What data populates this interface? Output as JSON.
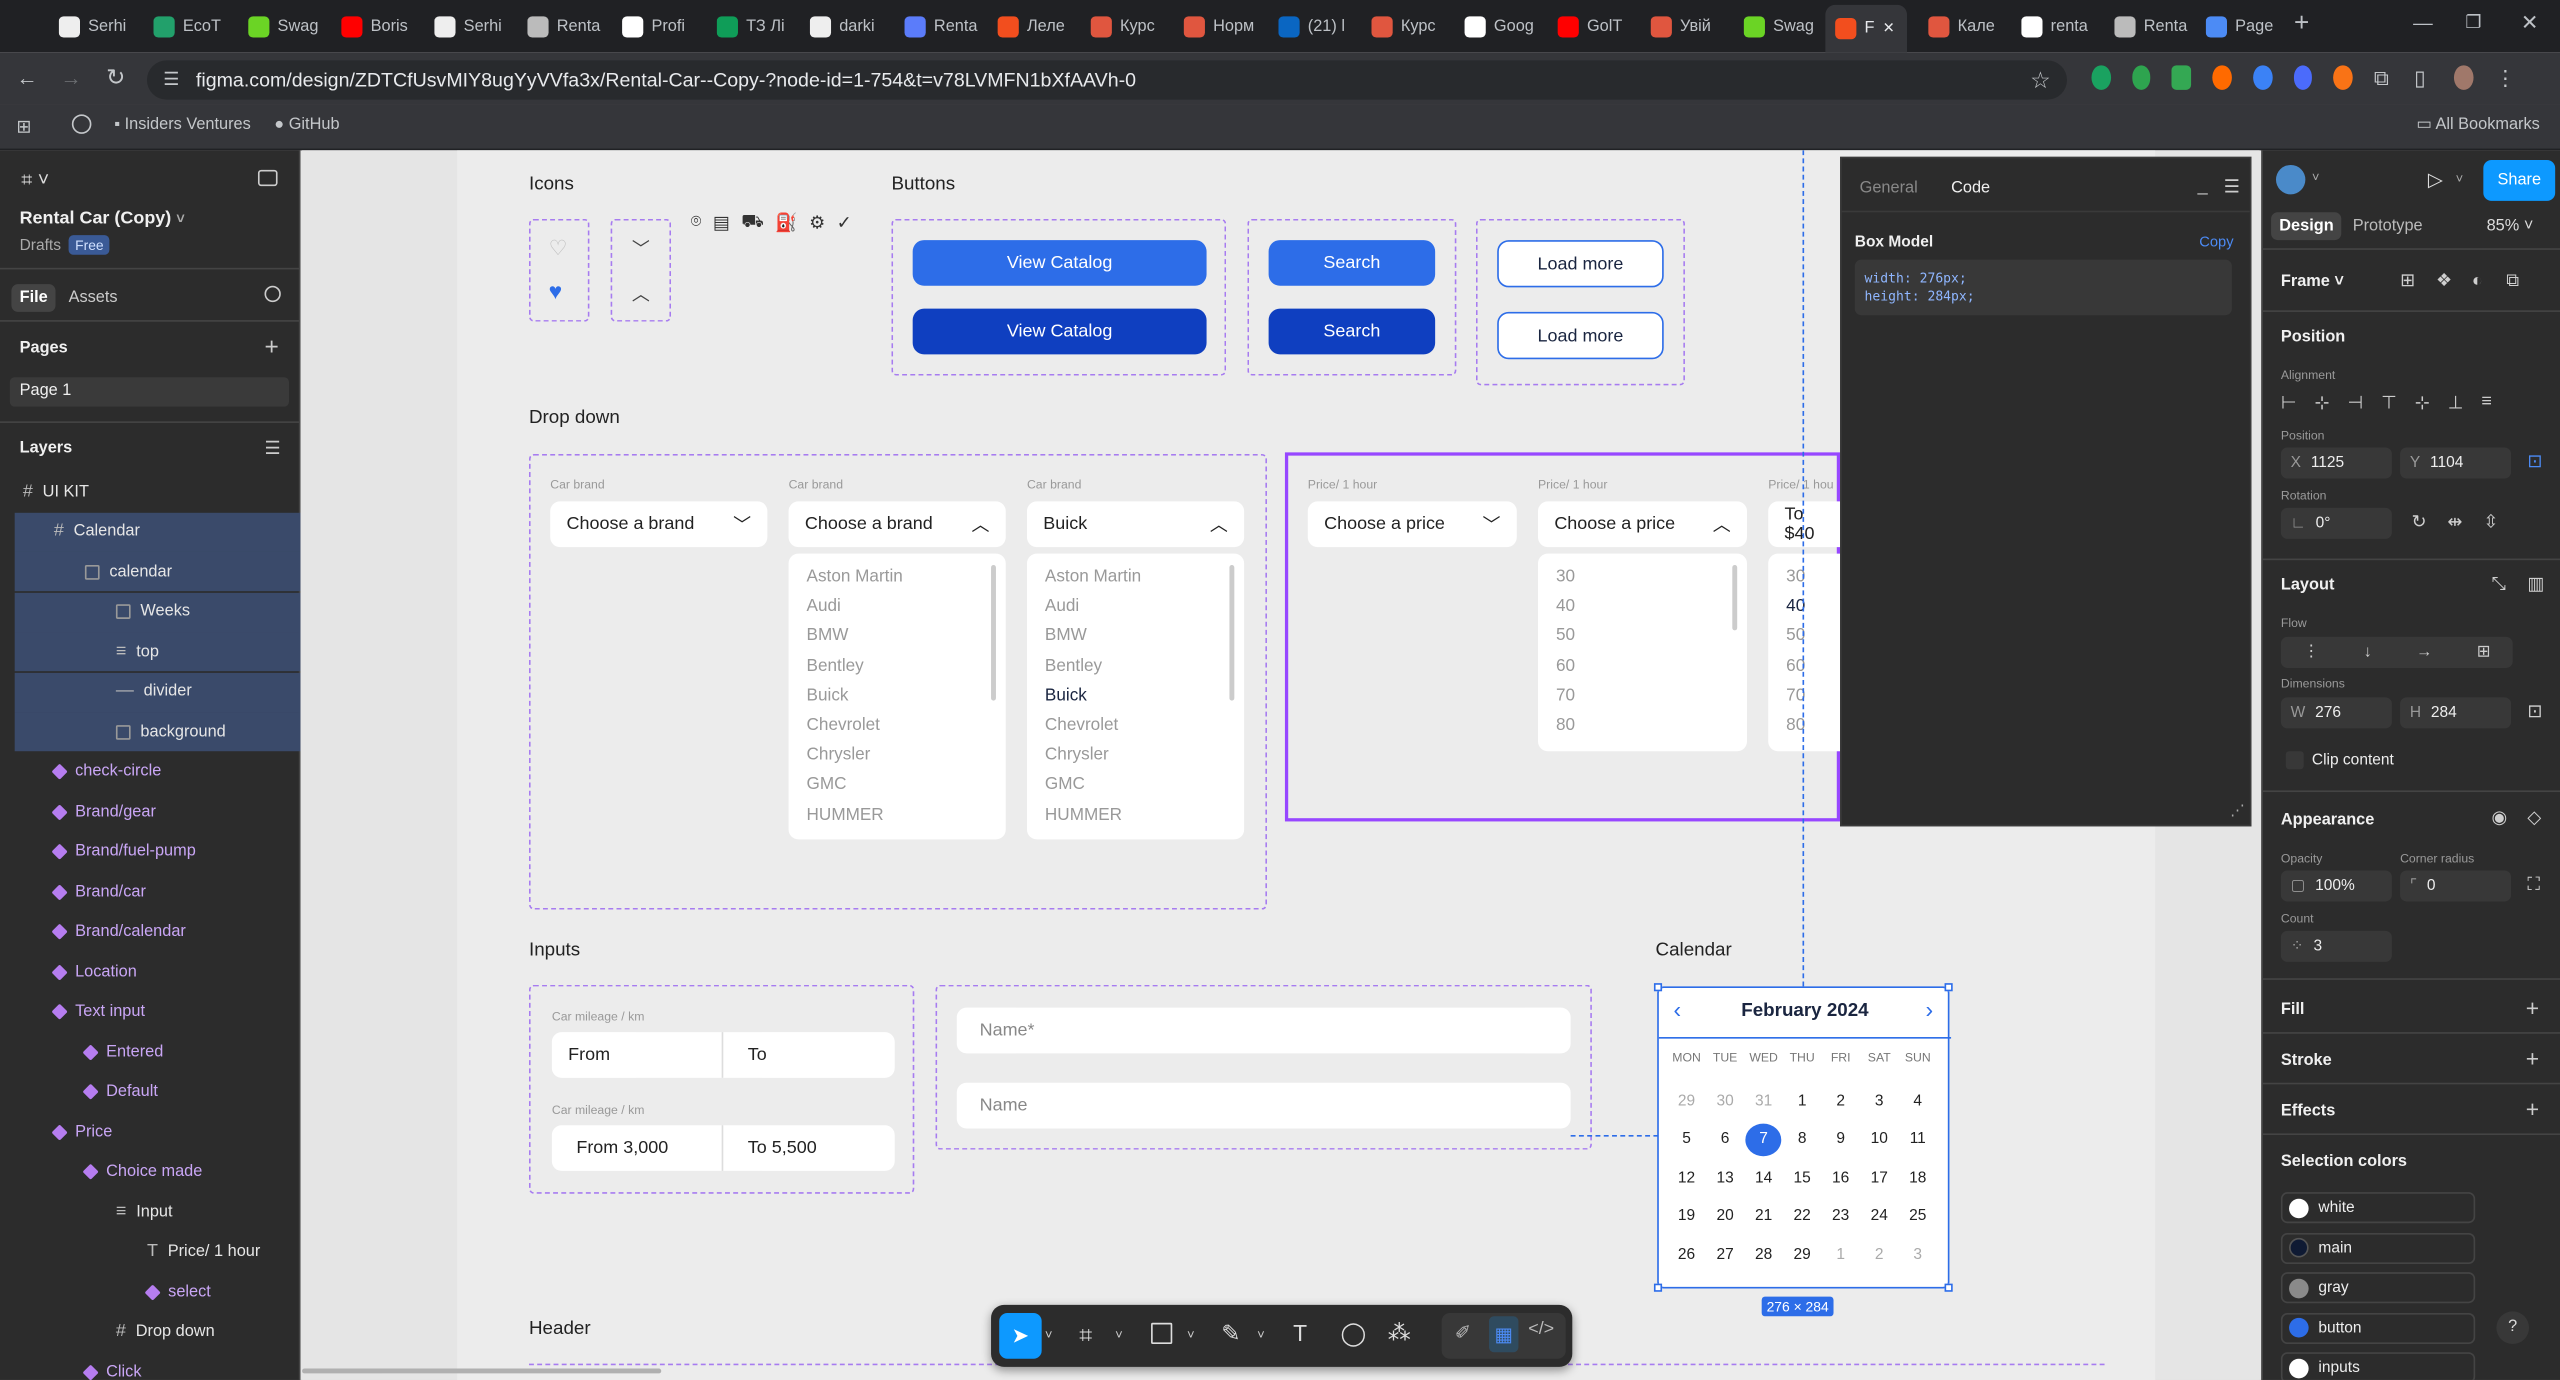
{
  "browser": {
    "tabs": [
      {
        "label": "Serhi",
        "color": "#eee"
      },
      {
        "label": "EcoT",
        "color": "#22a06b"
      },
      {
        "label": "Swag",
        "color": "#6bd425"
      },
      {
        "label": "Boris",
        "color": "#ff0000"
      },
      {
        "label": "Serhi",
        "color": "#eee"
      },
      {
        "label": "Renta",
        "color": "#bbb"
      },
      {
        "label": "Profi",
        "color": "#fff"
      },
      {
        "label": "ТЗ Лі",
        "color": "#0f9d58"
      },
      {
        "label": "darki",
        "color": "#eee"
      },
      {
        "label": "Renta",
        "color": "#5b7cfa"
      },
      {
        "label": "Леле",
        "color": "#f24e1e"
      },
      {
        "label": "Курс",
        "color": "#e0563f"
      },
      {
        "label": "Норм",
        "color": "#e0563f"
      },
      {
        "label": "(21) l",
        "color": "#0a66c2"
      },
      {
        "label": "Курс",
        "color": "#e0563f"
      },
      {
        "label": "Goog",
        "color": "#fff"
      },
      {
        "label": "GolT",
        "color": "#ff0000"
      },
      {
        "label": "Увій",
        "color": "#e0563f"
      },
      {
        "label": "Swag",
        "color": "#6bd425"
      },
      {
        "label": "F",
        "color": "#f24e1e"
      },
      {
        "label": "Кале",
        "color": "#e0563f"
      },
      {
        "label": "renta",
        "color": "#fff"
      },
      {
        "label": "Renta",
        "color": "#bbb"
      },
      {
        "label": "Page",
        "color": "#4c8bf5"
      }
    ],
    "url": "figma.com/design/ZDTCfUsvMIY8ugYyVVfa3x/Rental-Car--Copy-?node-id=1-754&t=v78LVMFN1bXfAAVh-0",
    "bookmarks": [
      "Insiders Ventures",
      "GitHub"
    ],
    "all_bookmarks": "All Bookmarks"
  },
  "left_panel": {
    "file_name": "Rental Car (Copy)",
    "drafts": "Drafts",
    "plan": "Free",
    "tabs": [
      "File",
      "Assets"
    ],
    "pages_title": "Pages",
    "page": "Page 1",
    "layers_title": "Layers",
    "layers": [
      {
        "label": "UI KIT",
        "indent": 0,
        "kind": "frame",
        "sel": false
      },
      {
        "label": "Calendar",
        "indent": 1,
        "kind": "frame",
        "sel": true
      },
      {
        "label": "calendar",
        "indent": 2,
        "kind": "box",
        "sel": true
      },
      {
        "label": "Weeks",
        "indent": 3,
        "kind": "box",
        "sel": true
      },
      {
        "label": "top",
        "indent": 3,
        "kind": "lines",
        "sel": true
      },
      {
        "label": "divider",
        "indent": 3,
        "kind": "line",
        "sel": true
      },
      {
        "label": "background",
        "indent": 3,
        "kind": "box",
        "sel": true
      },
      {
        "label": "check-circle",
        "indent": 1,
        "kind": "comp",
        "sel": false
      },
      {
        "label": "Brand/gear",
        "indent": 1,
        "kind": "comp",
        "sel": false
      },
      {
        "label": "Brand/fuel-pump",
        "indent": 1,
        "kind": "comp",
        "sel": false
      },
      {
        "label": "Brand/car",
        "indent": 1,
        "kind": "comp",
        "sel": false
      },
      {
        "label": "Brand/calendar",
        "indent": 1,
        "kind": "comp",
        "sel": false
      },
      {
        "label": "Location",
        "indent": 1,
        "kind": "comp",
        "sel": false
      },
      {
        "label": "Text input",
        "indent": 1,
        "kind": "comp",
        "sel": false
      },
      {
        "label": "Entered",
        "indent": 2,
        "kind": "comp",
        "sel": false
      },
      {
        "label": "Default",
        "indent": 2,
        "kind": "comp",
        "sel": false
      },
      {
        "label": "Price",
        "indent": 1,
        "kind": "comp",
        "sel": false
      },
      {
        "label": "Choice made",
        "indent": 2,
        "kind": "comp",
        "sel": false
      },
      {
        "label": "Input",
        "indent": 3,
        "kind": "lines",
        "sel": false
      },
      {
        "label": "Price/ 1 hour",
        "indent": 4,
        "kind": "text",
        "sel": false
      },
      {
        "label": "select",
        "indent": 4,
        "kind": "comp",
        "sel": false
      },
      {
        "label": "Drop down",
        "indent": 3,
        "kind": "frame",
        "sel": false
      },
      {
        "label": "Click",
        "indent": 2,
        "kind": "comp",
        "sel": false
      }
    ]
  },
  "canvas": {
    "icons_title": "Icons",
    "buttons_title": "Buttons",
    "btn_catalog": "View Catalog",
    "btn_search": "Search",
    "btn_load": "Load more",
    "dropdown_title": "Drop down",
    "car_brand_label": "Car brand",
    "choose_brand": "Choose a brand",
    "buick": "Buick",
    "brands": [
      "Aston Martin",
      "Audi",
      "BMW",
      "Bentley",
      "Buick",
      "Chevrolet",
      "Chrysler",
      "GMC",
      "HUMMER"
    ],
    "price_label": "Price/ 1 hour",
    "price_label_cut": "Price/ 1 hou",
    "choose_price": "Choose a price",
    "price_to": "To $40",
    "prices": [
      "30",
      "40",
      "50",
      "60",
      "70",
      "80"
    ],
    "inputs_title": "Inputs",
    "mileage_label": "Car mileage / km",
    "from": "From",
    "to": "To",
    "from_val": "From 3,000",
    "to_val": "To 5,500",
    "name_req": "Name*",
    "name": "Name",
    "calendar_title": "Calendar",
    "header_title": "Header",
    "calendar": {
      "month": "February 2024",
      "weekdays": [
        "MON",
        "TUE",
        "WED",
        "THU",
        "FRI",
        "SAT",
        "SUN"
      ],
      "weeks": [
        [
          "29",
          "30",
          "31",
          "1",
          "2",
          "3",
          "4"
        ],
        [
          "5",
          "6",
          "7",
          "8",
          "9",
          "10",
          "11"
        ],
        [
          "12",
          "13",
          "14",
          "15",
          "16",
          "17",
          "18"
        ],
        [
          "19",
          "20",
          "21",
          "22",
          "23",
          "24",
          "25"
        ],
        [
          "26",
          "27",
          "28",
          "29",
          "1",
          "2",
          "3"
        ]
      ],
      "selected": "7",
      "size_badge": "276 × 284"
    }
  },
  "code_panel": {
    "tabs": [
      "General",
      "Code"
    ],
    "title": "Box Model",
    "copy": "Copy",
    "line1": "width: 276px;",
    "line2": "height: 284px;"
  },
  "right_panel": {
    "share": "Share",
    "tabs": [
      "Design",
      "Prototype"
    ],
    "zoom": "85%",
    "frame": "Frame",
    "position": "Position",
    "alignment": "Alignment",
    "position_label": "Position",
    "x": "1125",
    "y": "1104",
    "rotation_label": "Rotation",
    "rotation": "0°",
    "layout": "Layout",
    "flow": "Flow",
    "dimensions": "Dimensions",
    "w": "276",
    "h": "284",
    "clip": "Clip content",
    "appearance": "Appearance",
    "opacity_label": "Opacity",
    "opacity": "100%",
    "radius_label": "Corner radius",
    "radius": "0",
    "count_label": "Count",
    "count": "3",
    "fill": "Fill",
    "stroke": "Stroke",
    "effects": "Effects",
    "selection_colors": "Selection colors",
    "colors": [
      {
        "name": "white",
        "hex": "#ffffff"
      },
      {
        "name": "main",
        "hex": "#0f1a33"
      },
      {
        "name": "gray",
        "hex": "#8a8a8a"
      },
      {
        "name": "button",
        "hex": "#2d6de8"
      },
      {
        "name": "inputs",
        "hex": "#ffffff"
      }
    ]
  }
}
